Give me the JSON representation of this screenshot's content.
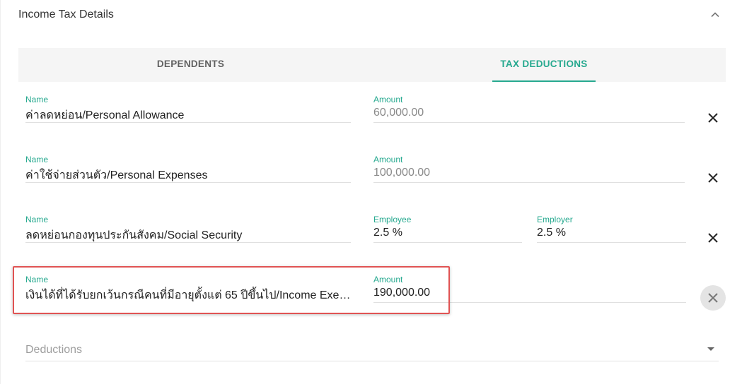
{
  "panel": {
    "title": "Income Tax Details"
  },
  "tabs": [
    {
      "label": "DEPENDENTS",
      "active": false
    },
    {
      "label": "TAX DEDUCTIONS",
      "active": true
    }
  ],
  "rows": [
    {
      "name_label": "Name",
      "name_value": "ค่าลดหย่อน/Personal Allowance",
      "amount_label": "Amount",
      "amount_value": "60,000.00"
    },
    {
      "name_label": "Name",
      "name_value": "ค่าใช้จ่ายส่วนตัว/Personal Expenses",
      "amount_label": "Amount",
      "amount_value": "100,000.00"
    },
    {
      "name_label": "Name",
      "name_value": "ลดหย่อนกองทุนประกันสังคม/Social Security",
      "employee_label": "Employee",
      "employee_value": "2.5 %",
      "employer_label": "Employer",
      "employer_value": "2.5 %"
    },
    {
      "name_label": "Name",
      "name_value": "เงินได้ที่ได้รับยกเว้นกรณีคนที่มีอายุตั้งแต่ 65 ปีขึ้นไป/Income Exemp...",
      "amount_label": "Amount",
      "amount_value": "190,000.00"
    }
  ],
  "deductions_select": {
    "placeholder": "Deductions"
  },
  "colors": {
    "accent": "#26a98f",
    "highlight": "#e05353"
  }
}
